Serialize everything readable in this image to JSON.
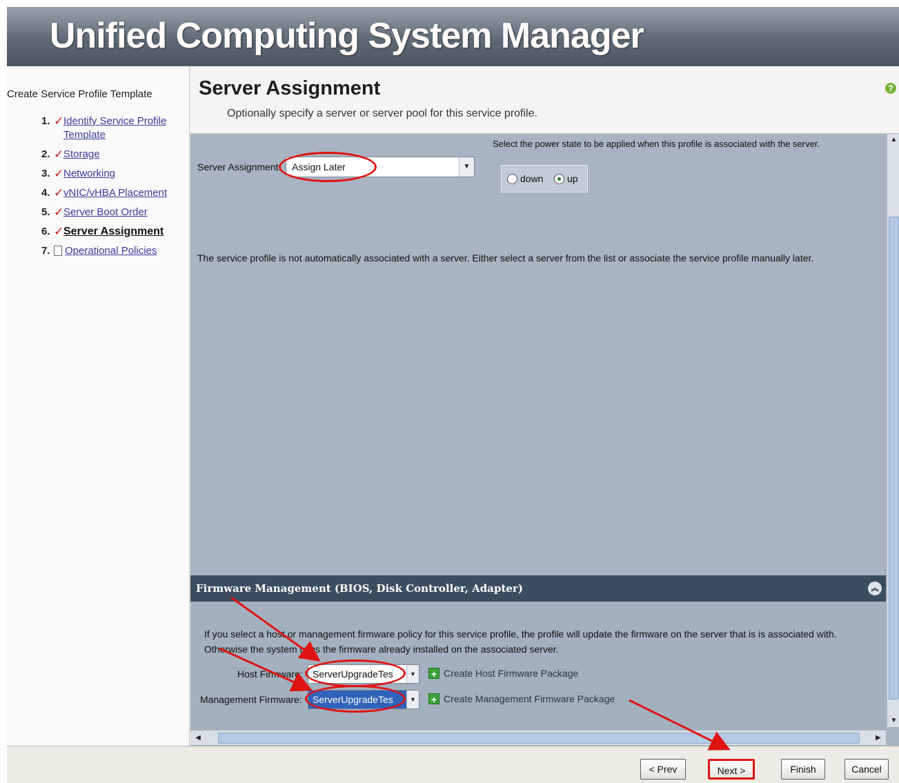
{
  "app": {
    "title": "Unified Computing System Manager"
  },
  "sidebar": {
    "wizard_title": "Create Service Profile Template",
    "steps": [
      {
        "num": "1.",
        "label": "Identify Service Profile Template",
        "status": "done"
      },
      {
        "num": "2.",
        "label": "Storage",
        "status": "done"
      },
      {
        "num": "3.",
        "label": "Networking",
        "status": "done"
      },
      {
        "num": "4.",
        "label": "vNIC/vHBA Placement",
        "status": "done"
      },
      {
        "num": "5.",
        "label": "Server Boot Order",
        "status": "done"
      },
      {
        "num": "6.",
        "label": "Server Assignment",
        "status": "current"
      },
      {
        "num": "7.",
        "label": "Operational Policies",
        "status": "pending"
      }
    ]
  },
  "header": {
    "title": "Server Assignment",
    "subtitle": "Optionally specify a server or server pool for this service profile."
  },
  "form": {
    "server_assignment_label": "Server Assignment:",
    "server_assignment_value": "Assign Later",
    "power_state_label": "Select the power state to be applied when this profile is associated with the server.",
    "power_options": [
      {
        "label": "down",
        "selected": false
      },
      {
        "label": "up",
        "selected": true
      }
    ],
    "info_text": "The service profile is not automatically associated with a server. Either select a server from the list or associate the service profile manually later."
  },
  "firmware": {
    "header": "Firmware Management (BIOS, Disk Controller, Adapter)",
    "description": "If you select a host or management firmware policy for this service profile, the profile will update the firmware on the server that is is associated with. Otherwise the system uses the firmware already installed on the associated server.",
    "host_label": "Host Firmware:",
    "host_value": "ServerUpgradeTes",
    "host_create": "Create Host Firmware Package",
    "mgmt_label": "Management Firmware:",
    "mgmt_value": "ServerUpgradeTes",
    "mgmt_create": "Create Management Firmware Package"
  },
  "footer": {
    "prev": "< Prev",
    "next": "Next >",
    "finish": "Finish",
    "cancel": "Cancel"
  },
  "colors": {
    "annotation": "#e01313",
    "panel": "#a8b4c1",
    "header_bar": "#3b4d5f"
  }
}
